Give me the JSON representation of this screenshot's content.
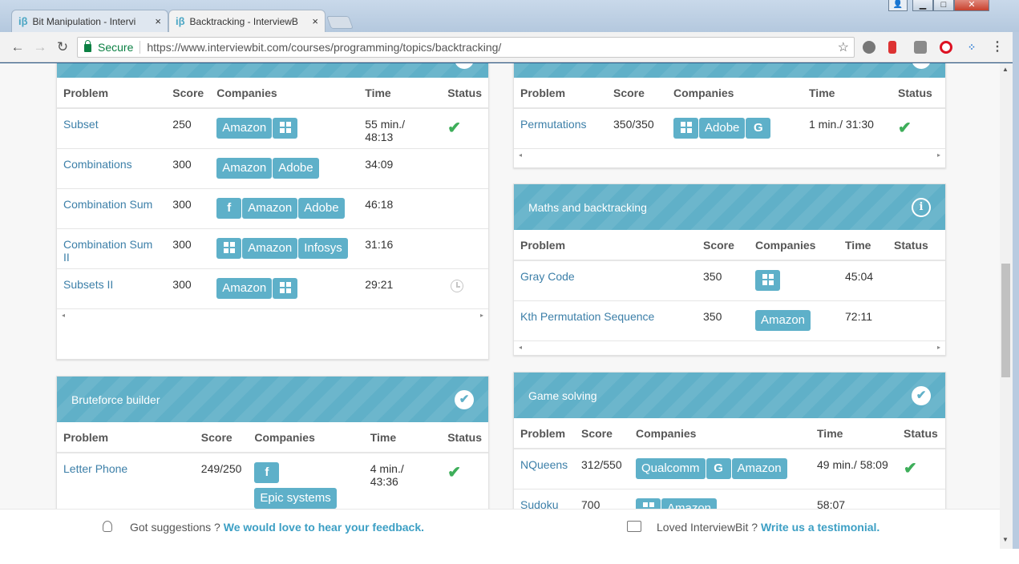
{
  "browser": {
    "tabs": [
      {
        "logo": "iβ",
        "title": "Bit Manipulation - Intervi"
      },
      {
        "logo": "iβ",
        "title": "Backtracking - InterviewB"
      }
    ],
    "tab_close": "×",
    "secure_label": "Secure",
    "url": "https://www.interviewbit.com/courses/programming/topics/backtracking/",
    "window_controls": {
      "minimize": "▁",
      "maximize": "□",
      "close": "✕",
      "person": "👤"
    }
  },
  "column_headers": {
    "problem": "Problem",
    "score": "Score",
    "companies": "Companies",
    "time": "Time",
    "status": "Status"
  },
  "sections": {
    "subsets_combinations": {
      "rows": [
        {
          "problem": [
            "Subset"
          ],
          "score": "250",
          "companies": [
            "Amazon",
            "#windows"
          ],
          "time": "55 min./ 48:13",
          "status": "solved"
        },
        {
          "problem": [
            "Combinations"
          ],
          "score": "300",
          "companies": [
            "Amazon",
            "Adobe"
          ],
          "time": "34:09",
          "status": ""
        },
        {
          "problem": [
            "Combination Sum"
          ],
          "score": "300",
          "companies": [
            "#facebook",
            "Amazon",
            "Adobe"
          ],
          "time": "46:18",
          "status": ""
        },
        {
          "problem": [
            "Combination Sum",
            "II"
          ],
          "score": "300",
          "companies": [
            "#windows",
            "Amazon",
            "Infosys"
          ],
          "time": "31:16",
          "status": ""
        },
        {
          "problem": [
            "Subsets II"
          ],
          "score": "300",
          "companies": [
            "Amazon",
            "#windows"
          ],
          "time": "29:21",
          "status": "timer"
        }
      ]
    },
    "permutations_top": {
      "rows": [
        {
          "problem": [
            "Permutations"
          ],
          "score": "350/350",
          "companies": [
            "#windows",
            "Adobe",
            "#google"
          ],
          "time": "1 min./ 31:30",
          "status": "solved"
        }
      ]
    },
    "maths_backtracking": {
      "title": "Maths and backtracking",
      "head_icon": "i",
      "rows": [
        {
          "problem": [
            "Gray Code"
          ],
          "score": "350",
          "companies": [
            "#windows"
          ],
          "time": "45:04",
          "status": ""
        },
        {
          "problem": [
            "Kth Permutation Sequence"
          ],
          "score": "350",
          "companies": [
            "Amazon"
          ],
          "time": "72:11",
          "status": ""
        }
      ]
    },
    "bruteforce_builder": {
      "title": "Bruteforce builder",
      "head_icon": "✔",
      "rows": [
        {
          "problem": [
            "Letter Phone"
          ],
          "score": "249/250",
          "companies": [
            "#facebook",
            "Epic systems"
          ],
          "time": "4 min./ 43:36",
          "status": "solved"
        }
      ]
    },
    "game_solving": {
      "title": "Game solving",
      "head_icon": "✔",
      "rows": [
        {
          "problem": [
            "NQueens"
          ],
          "score": "312/550",
          "companies": [
            "Qualcomm",
            "#google",
            "Amazon"
          ],
          "time": "49 min./ 58:09",
          "status": "solved"
        },
        {
          "problem": [
            "Sudoku"
          ],
          "score": "700",
          "companies": [
            "#windows",
            "Amazon"
          ],
          "time": "58:07",
          "status": ""
        }
      ]
    }
  },
  "icons": {
    "check": "✔",
    "facebook": "f",
    "google": "G"
  },
  "footer": {
    "suggest_text": "Got suggestions ?",
    "suggest_link": "We would love to hear your feedback.",
    "loved_text": "Loved InterviewBit ?",
    "loved_link": "Write us a testimonial."
  },
  "colors": {
    "accent": "#60b0c8",
    "badge": "#5eb0c9",
    "link": "#3c7fa8",
    "success": "#3eae5a"
  }
}
